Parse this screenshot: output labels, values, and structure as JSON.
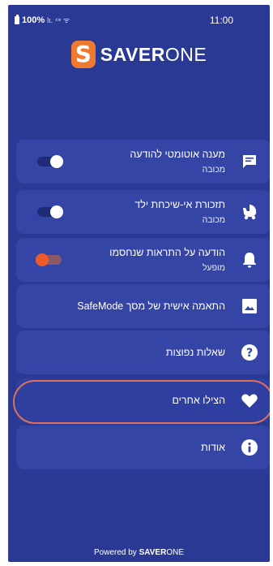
{
  "status": {
    "battery": "100%",
    "signal": "lı. ⁴⁹ ᯤ",
    "time": "11:00"
  },
  "logo": {
    "mark": "S",
    "text_bold": "SAVER",
    "text_light": "ONE"
  },
  "menu": [
    {
      "title": "מענה אוטומטי להודעה",
      "subtitle": "מכובה",
      "icon": "chat-reply-icon",
      "toggle": "on"
    },
    {
      "title": "תזכורת אי-שיכחת ילד",
      "subtitle": "מכובה",
      "icon": "stroller-icon",
      "toggle": "on"
    },
    {
      "title": "הודעה על התראות שנחסמו",
      "subtitle": "מופעל",
      "icon": "bell-icon",
      "toggle": "off"
    },
    {
      "title": "התאמה אישית של מסך SafeMode",
      "icon": "image-icon"
    },
    {
      "title": "שאלות נפוצות",
      "icon": "question-icon"
    },
    {
      "title": "הצילו אחרים",
      "icon": "heart-icon"
    },
    {
      "title": "אודות",
      "icon": "info-icon"
    }
  ],
  "footer": {
    "prefix": "Powered by ",
    "brand_bold": "SAVER",
    "brand_light": "ONE"
  },
  "colors": {
    "background": "#2a3a94",
    "card": "#3545a6",
    "accent": "#ef7a2f",
    "highlight": "#e0705a"
  }
}
